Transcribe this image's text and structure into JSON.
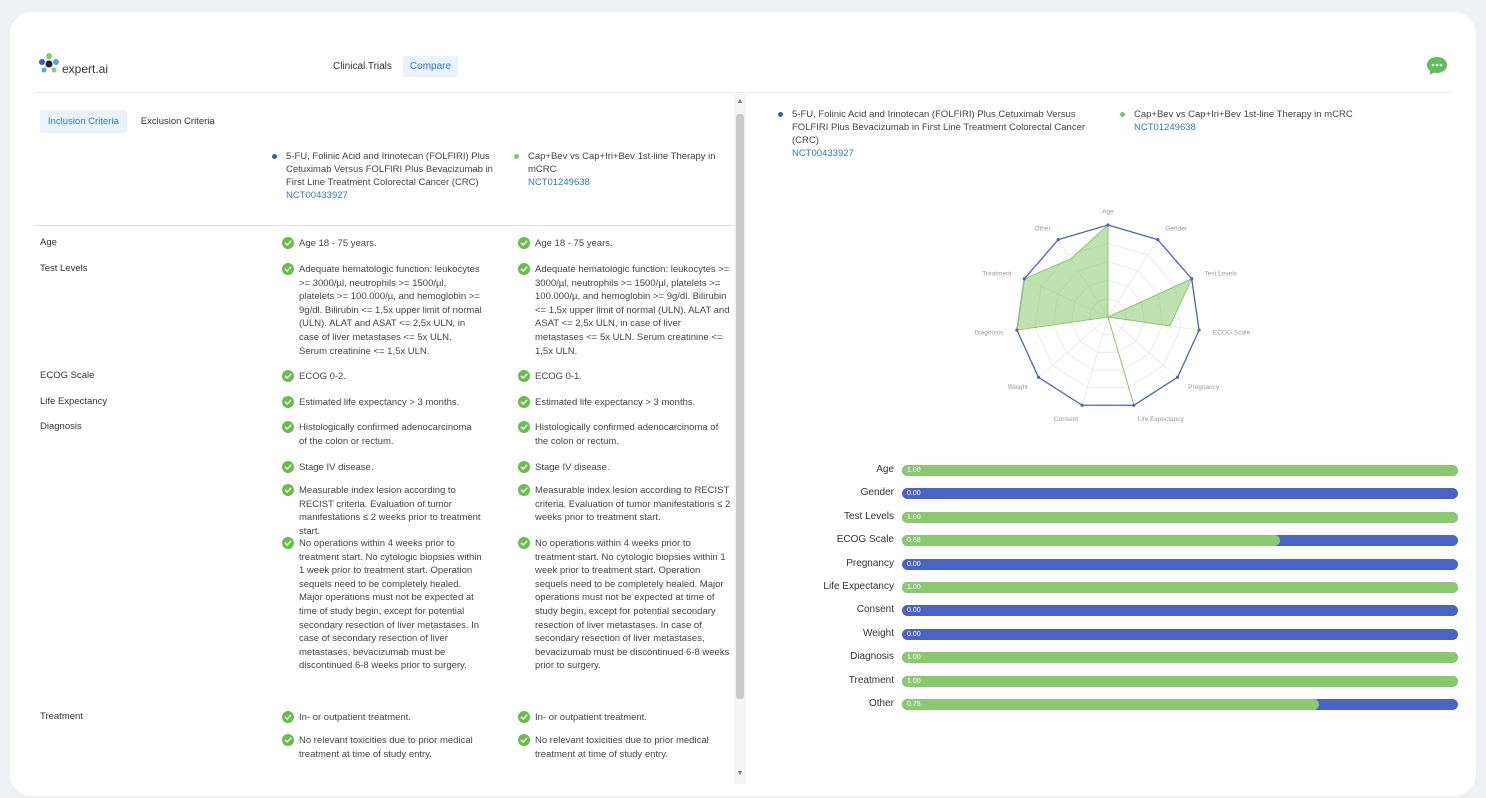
{
  "app": {
    "logo_text": "expert.ai",
    "nav": [
      "Clinical Trials",
      "Compare"
    ],
    "nav_active": 1
  },
  "criteria_tabs": {
    "inclusion": "Inclusion Criteria",
    "exclusion": "Exclusion Criteria"
  },
  "colors": {
    "trial1": "#3f57c4",
    "trial2": "#7dc466",
    "accent": "#2a7bd5",
    "check": "#6abd4a",
    "chat": "#5cbf5a"
  },
  "trials": [
    {
      "title": "5-FU, Folinic Acid and Irinotecan (FOLFIRI) Plus Cetuximab Versus FOLFIRI Plus Bevacizumab in First Line Treatment Colorectal Cancer (CRC)",
      "nct": "NCT00433927"
    },
    {
      "title": "Cap+Bev vs Cap+Iri+Bev 1st-line Therapy in mCRC",
      "nct": "NCT01249638"
    }
  ],
  "rows": [
    {
      "label": "Age",
      "items": [
        [
          "Age 18 - 75 years.",
          "Age 18 - 75 years."
        ]
      ]
    },
    {
      "label": "Test Levels",
      "items": [
        [
          "Adequate hematologic function: leukocytes >= 3000/µl, neutrophils >= 1500/µl, platelets >= 100.000/µ, and hemoglobin >= 9g/dl. Bilirubin <= 1,5x upper limit of normal (ULN). ALAT and ASAT <= 2,5x ULN, in case of liver metastases <= 5x ULN. Serum creatinine <= 1,5x ULN.",
          "Adequate hematologic function: leukocytes >= 3000/µl, neutrophils >= 1500/µl, platelets >= 100.000/µ, and hemoglobin >= 9g/dl. Bilirubin <= 1,5x upper limit of normal (ULN). ALAT and ASAT <= 2,5x ULN, in case of liver metastases <= 5x ULN. Serum creatinine <= 1,5x ULN."
        ]
      ]
    },
    {
      "label": "ECOG Scale",
      "items": [
        [
          "ECOG 0-2.",
          "ECOG 0-1."
        ]
      ]
    },
    {
      "label": "Life Expectancy",
      "items": [
        [
          "Estimated life expectancy > 3 months.",
          "Estimated life expectancy > 3 months."
        ]
      ]
    },
    {
      "label": "Diagnosis",
      "items": [
        [
          "Histologically confirmed adenocarcinoma of the colon or rectum.",
          "Histologically confirmed adenocarcinoma of the colon or rectum."
        ],
        [
          "Stage IV disease.",
          "Stage IV disease."
        ],
        [
          "Measurable index lesion according to RECIST criteria. Evaluation of tumor manifestations ≤ 2 weeks prior to treatment start.",
          "Measurable index lesion according to RECIST criteria. Evaluation of tumor manifestations ≤ 2 weeks prior to treatment start."
        ],
        [
          "No operations within 4 weeks prior to treatment start. No cytologic biopsies within 1 week prior to treatment start. Operation sequels need to be completely healed. Major operations must not be expected at time of study begin, except for potential secondary resection of liver metastases. In case of secondary resection of liver metastases, bevacizumab must be discontinued 6-8 weeks prior to surgery.",
          "No operations within 4 weeks prior to treatment start. No cytologic biopsies within 1 week prior to treatment start. Operation sequels need to be completely healed. Major operations must not be expected at time of study begin, except for potential secondary resection of liver metastases. In case of secondary resection of liver metastases, bevacizumab must be discontinued 6-8 weeks prior to surgery."
        ]
      ]
    },
    {
      "label": "Treatment",
      "items": [
        [
          "In- or outpatient treatment.",
          "In- or outpatient treatment."
        ],
        [
          "No relevant toxicities due to prior medical treatment at time of study entry.",
          "No relevant toxicities due to prior medical treatment at time of study entry."
        ]
      ]
    }
  ],
  "radar": {
    "axes": [
      "Age",
      "Gender",
      "Test Levels",
      "ECOG Scale",
      "Pregnancy",
      "Life Expectancy",
      "Consent",
      "Weight",
      "Diagnosis",
      "Treatment",
      "Other"
    ],
    "values": [
      1.0,
      0.0,
      1.0,
      0.68,
      0.0,
      1.0,
      0.0,
      0.0,
      1.0,
      1.0,
      0.75
    ]
  },
  "scores": [
    {
      "label": "Age",
      "value": 1.0,
      "text": "1.00"
    },
    {
      "label": "Gender",
      "value": 0.0,
      "text": "0.00"
    },
    {
      "label": "Test Levels",
      "value": 1.0,
      "text": "1.00"
    },
    {
      "label": "ECOG Scale",
      "value": 0.68,
      "text": "0.68"
    },
    {
      "label": "Pregnancy",
      "value": 0.0,
      "text": "0.00"
    },
    {
      "label": "Life Expectancy",
      "value": 1.0,
      "text": "1.00"
    },
    {
      "label": "Consent",
      "value": 0.0,
      "text": "0.00"
    },
    {
      "label": "Weight",
      "value": 0.0,
      "text": "0.00"
    },
    {
      "label": "Diagnosis",
      "value": 1.0,
      "text": "1.00"
    },
    {
      "label": "Treatment",
      "value": 1.0,
      "text": "1.00"
    },
    {
      "label": "Other",
      "value": 0.75,
      "text": "0.75"
    }
  ]
}
